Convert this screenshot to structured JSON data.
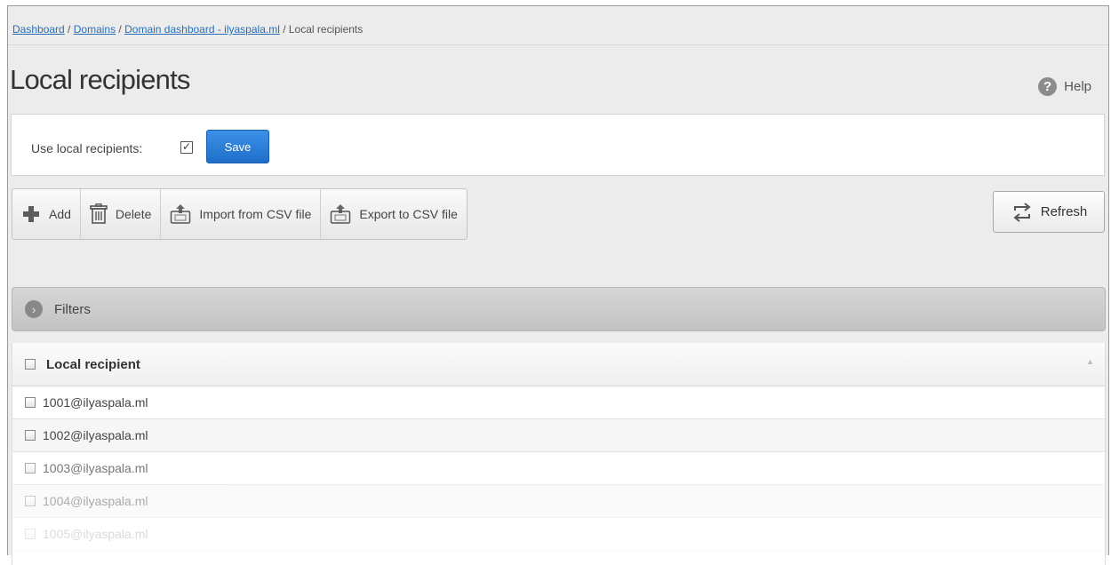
{
  "breadcrumb": {
    "dashboard": "Dashboard",
    "sep1": " / ",
    "domains": "Domains",
    "sep2": " / ",
    "domain_dashboard": "Domain dashboard - ilyaspala.ml",
    "sep3": " / ",
    "current": "Local recipients"
  },
  "page": {
    "title": "Local recipients",
    "help_label": "Help"
  },
  "settings": {
    "use_local_label": "Use local recipients:",
    "use_local_checked": true,
    "save_label": "Save"
  },
  "toolbar": {
    "add_label": "Add",
    "delete_label": "Delete",
    "import_label": "Import from CSV file",
    "export_label": "Export to CSV file",
    "refresh_label": "Refresh"
  },
  "filters": {
    "label": "Filters"
  },
  "table": {
    "column_header": "Local recipient",
    "rows": [
      "1001@ilyaspala.ml",
      "1002@ilyaspala.ml",
      "1003@ilyaspala.ml",
      "1004@ilyaspala.ml",
      "1005@ilyaspala.ml"
    ]
  },
  "colors": {
    "accent": "#1f6fc9",
    "link": "#2a6fb5"
  }
}
